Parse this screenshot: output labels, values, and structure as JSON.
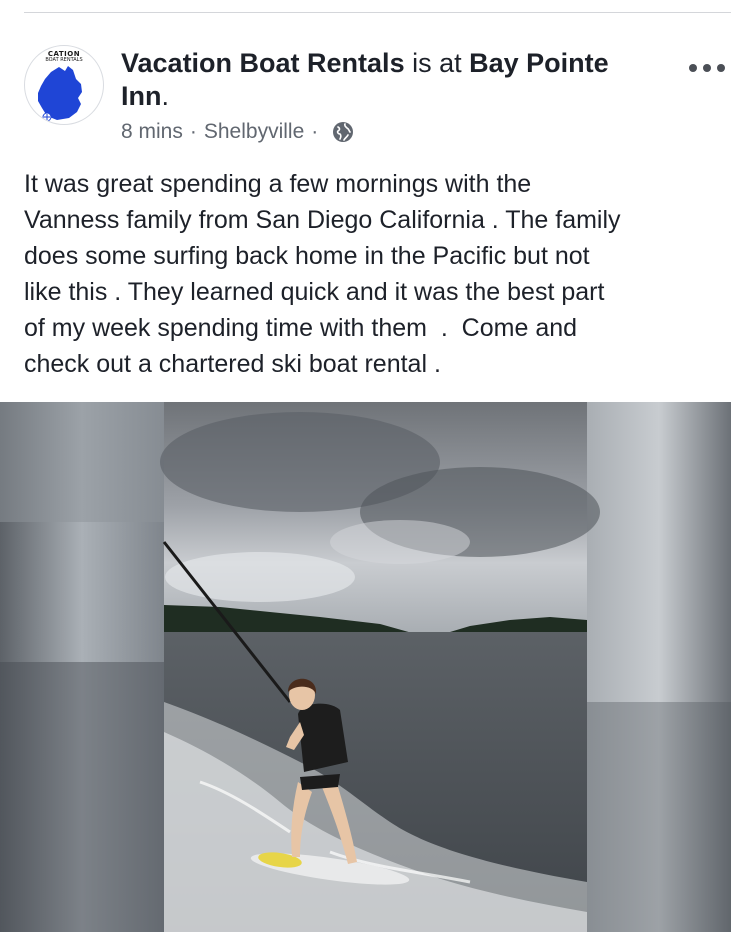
{
  "post": {
    "author": "Vacation Boat Rentals",
    "is_at": " is at ",
    "location_name": "Bay Pointe",
    "location_name_line2": "Inn",
    "period": ".",
    "timestamp": "8 mins",
    "place": "Shelbyville",
    "separator": "·",
    "privacy_icon": "globe-icon",
    "more_icon": "more-options-icon",
    "avatar_text": "CATION",
    "avatar_subtext": "BOAT RENTALS",
    "body": "It was great spending a few mornings with the\nVanness family from San Diego California . The family\ndoes some surfing back home in the Pacific but not\nlike this . They learned quick and it was the best part\nof my week spending time with them  .  Come and\ncheck out a chartered ski boat rental ."
  },
  "colors": {
    "text_primary": "#1d2129",
    "text_secondary": "#616770",
    "avatar_map": "#1f45d6"
  }
}
